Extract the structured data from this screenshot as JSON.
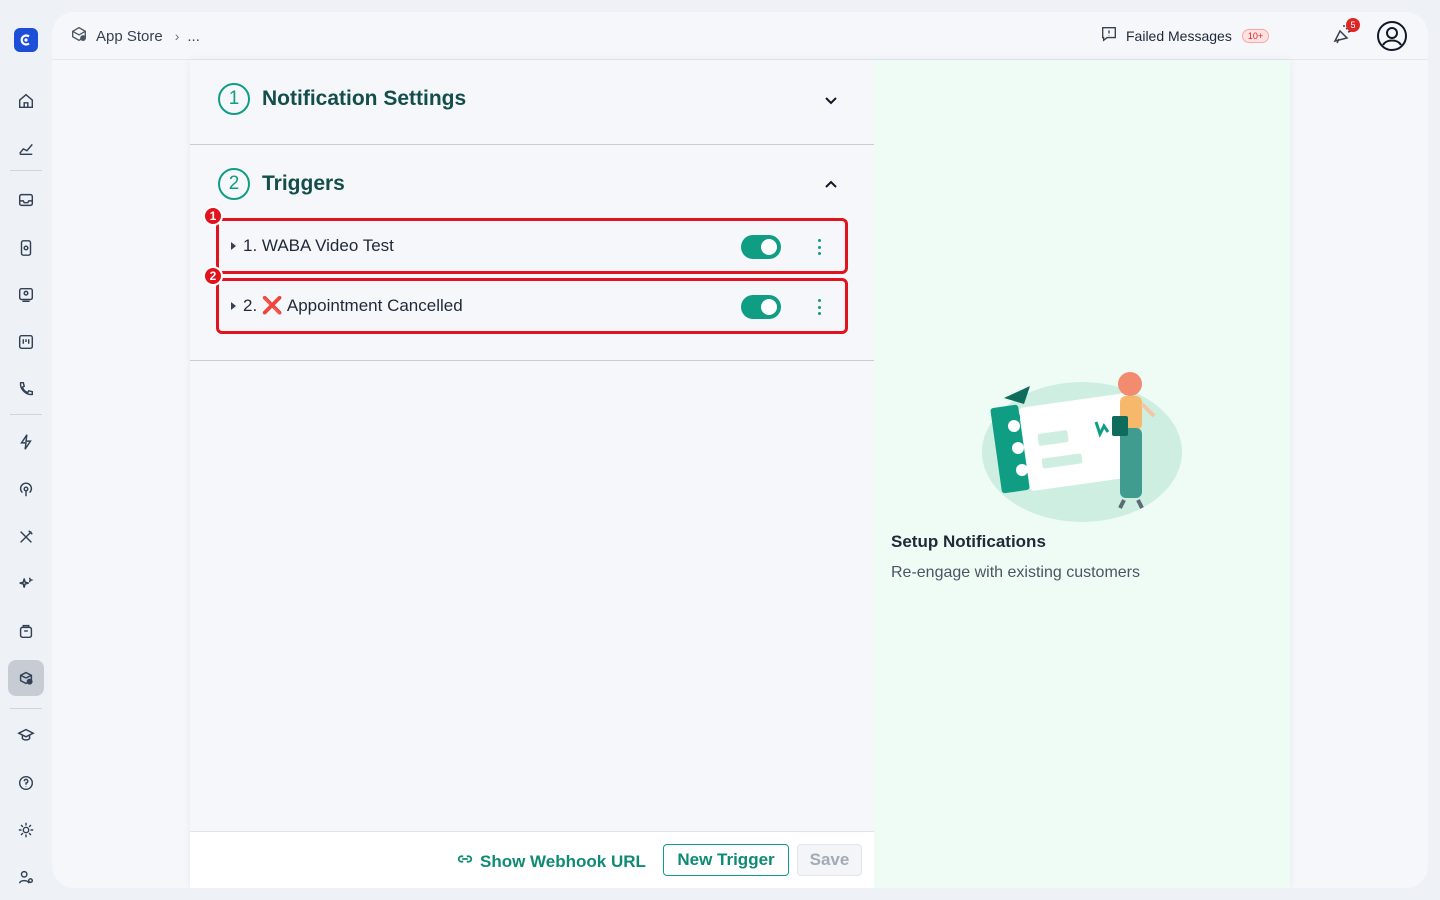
{
  "topbar": {
    "breadcrumb_root": "App Store",
    "breadcrumb_more": "...",
    "failed_messages_label": "Failed Messages",
    "failed_messages_badge": "10+",
    "notifications_count": "5"
  },
  "sections": {
    "notification_settings": {
      "number": "1",
      "title": "Notification Settings"
    },
    "triggers": {
      "number": "2",
      "title": "Triggers"
    }
  },
  "triggers": [
    {
      "label": "1. WABA Video Test",
      "enabled": true,
      "marker": "1"
    },
    {
      "prefix": "2.",
      "emoji": "❌",
      "label": "Appointment Cancelled",
      "enabled": true,
      "marker": "2"
    }
  ],
  "footer": {
    "webhook_label": "Show Webhook URL",
    "new_trigger_label": "New Trigger",
    "save_label": "Save"
  },
  "aside": {
    "title": "Setup Notifications",
    "subtitle": "Re-engage with existing customers"
  },
  "colors": {
    "accent": "#0f9d84",
    "highlight": "#e3131d",
    "aside_bg": "#effcf6"
  }
}
